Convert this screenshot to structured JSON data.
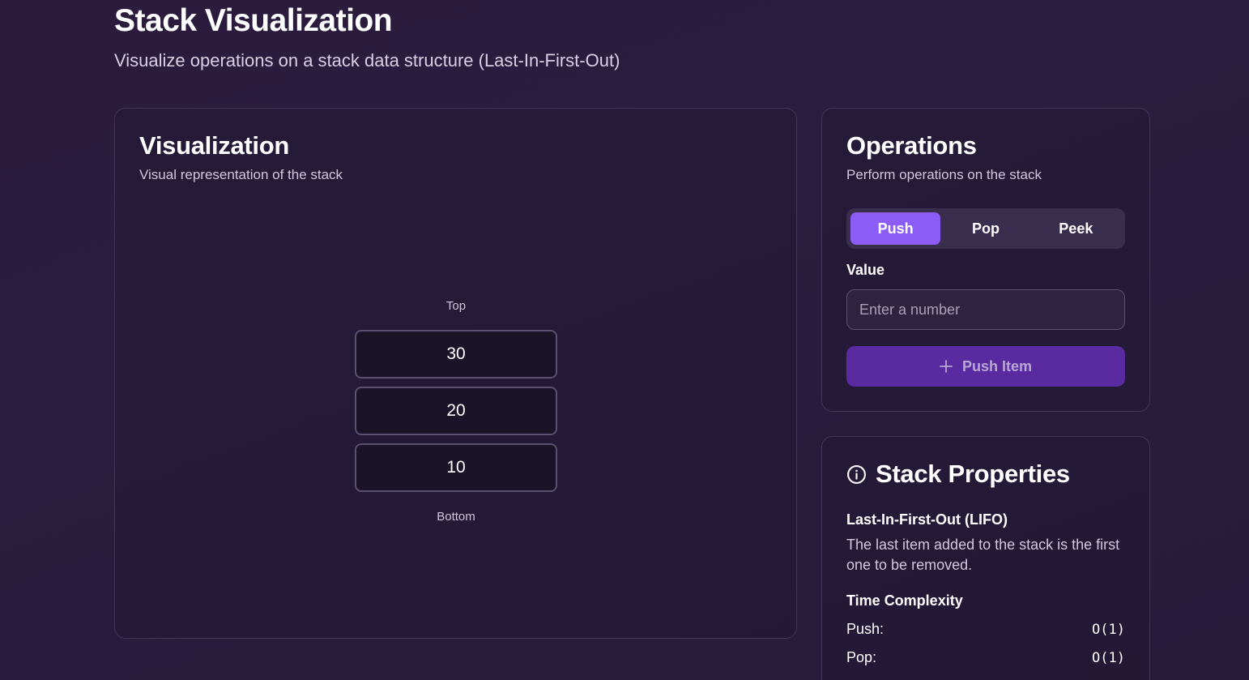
{
  "header": {
    "title": "Stack Visualization",
    "subtitle": "Visualize operations on a stack data structure (Last-In-First-Out)"
  },
  "visualization": {
    "title": "Visualization",
    "description": "Visual representation of the stack",
    "top_label": "Top",
    "bottom_label": "Bottom",
    "items": [
      "30",
      "20",
      "10"
    ]
  },
  "operations": {
    "title": "Operations",
    "description": "Perform operations on the stack",
    "tabs": [
      {
        "label": "Push",
        "active": true
      },
      {
        "label": "Pop",
        "active": false
      },
      {
        "label": "Peek",
        "active": false
      }
    ],
    "value_label": "Value",
    "value_input": {
      "value": "",
      "placeholder": "Enter a number"
    },
    "push_button_label": "Push Item",
    "push_button_icon": "plus-icon"
  },
  "properties": {
    "title": "Stack Properties",
    "title_icon": "info-icon",
    "lifo_heading": "Last-In-First-Out (LIFO)",
    "lifo_text": "The last item added to the stack is the first one to be removed.",
    "time_complexity_heading": "Time Complexity",
    "time_complexity": [
      {
        "op": "Push:",
        "value": "O(1)"
      },
      {
        "op": "Pop:",
        "value": "O(1)"
      }
    ]
  },
  "colors": {
    "accent": "#8b5cf6",
    "button": "#5a2aa0",
    "background": "#2a1d3f"
  }
}
